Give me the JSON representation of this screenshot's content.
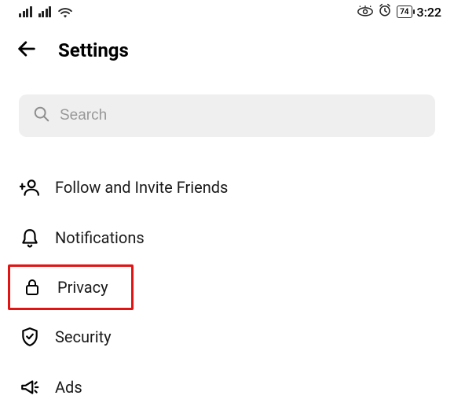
{
  "status": {
    "battery_pct": "74",
    "time": "3:22"
  },
  "header": {
    "title": "Settings"
  },
  "search": {
    "placeholder": "Search"
  },
  "settings": {
    "follow_invite": "Follow and Invite Friends",
    "notifications": "Notifications",
    "privacy": "Privacy",
    "security": "Security",
    "ads": "Ads"
  },
  "highlight_color": "#e11414"
}
